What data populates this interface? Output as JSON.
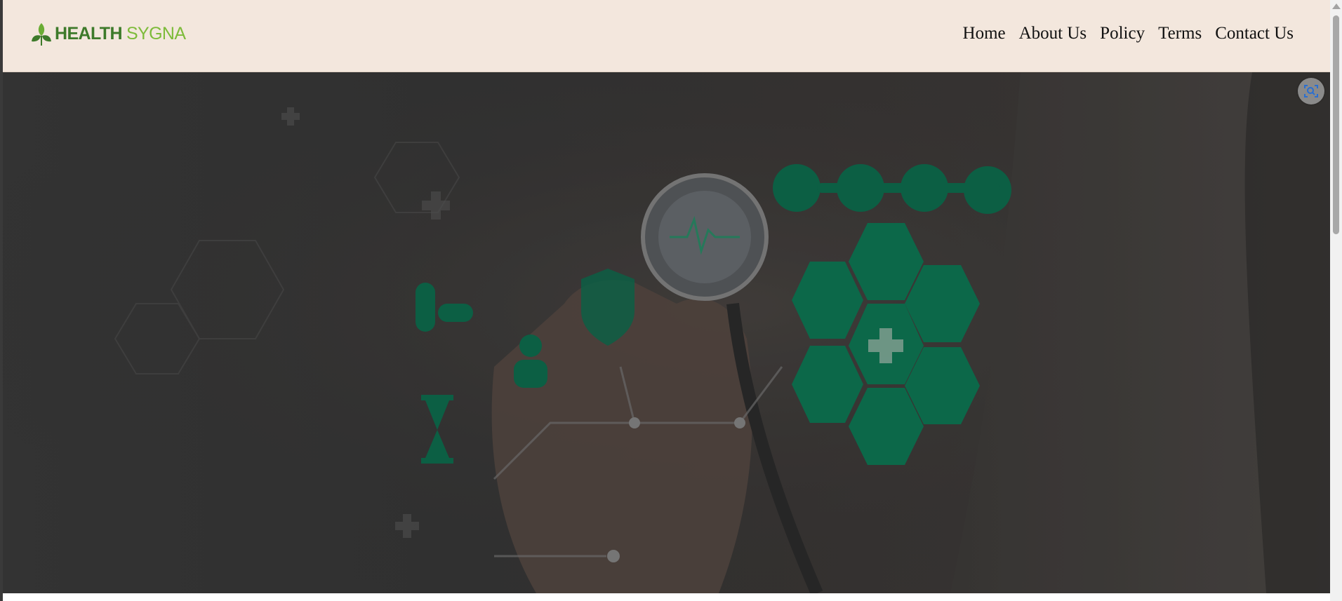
{
  "brand": {
    "logo_part1": "HEALTH",
    "logo_part2": "SYGNA",
    "primary_color": "#3d7a2a",
    "secondary_color": "#7dbb3a"
  },
  "nav": {
    "items": [
      {
        "label": "Home"
      },
      {
        "label": "About Us"
      },
      {
        "label": "Policy"
      },
      {
        "label": "Terms"
      },
      {
        "label": "Contact Us"
      }
    ]
  },
  "hero": {
    "image_description_icon": "medical-hexagon-icons",
    "accent_color": "#0a7a55",
    "header_background": "#f3e7dd"
  },
  "icons": {
    "scan_button": "visual-search-icon",
    "scroll_up": "scroll-up-arrow-icon"
  }
}
